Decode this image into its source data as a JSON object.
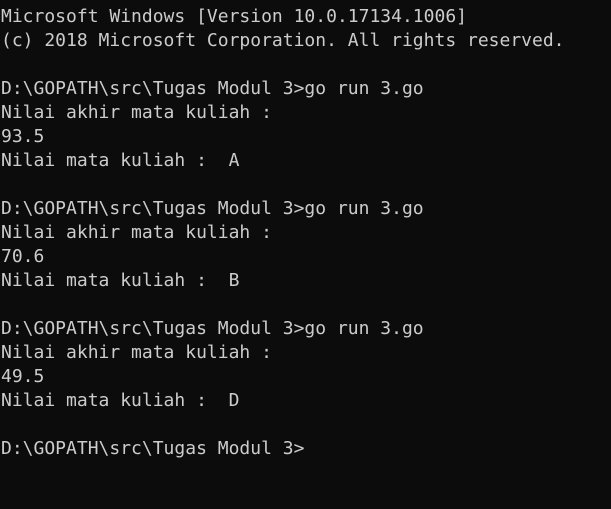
{
  "window": {
    "type": "command-prompt"
  },
  "console": {
    "lines": [
      "Microsoft Windows [Version 10.0.17134.1006]",
      "(c) 2018 Microsoft Corporation. All rights reserved.",
      "",
      "D:\\GOPATH\\src\\Tugas Modul 3>go run 3.go",
      "Nilai akhir mata kuliah :",
      "93.5",
      "Nilai mata kuliah :  A",
      "",
      "D:\\GOPATH\\src\\Tugas Modul 3>go run 3.go",
      "Nilai akhir mata kuliah :",
      "70.6",
      "Nilai mata kuliah :  B",
      "",
      "D:\\GOPATH\\src\\Tugas Modul 3>go run 3.go",
      "Nilai akhir mata kuliah :",
      "49.5",
      "Nilai mata kuliah :  D",
      "",
      "D:\\GOPATH\\src\\Tugas Modul 3>"
    ]
  },
  "colors": {
    "background": "#0c0c0c",
    "text": "#cccccc"
  }
}
